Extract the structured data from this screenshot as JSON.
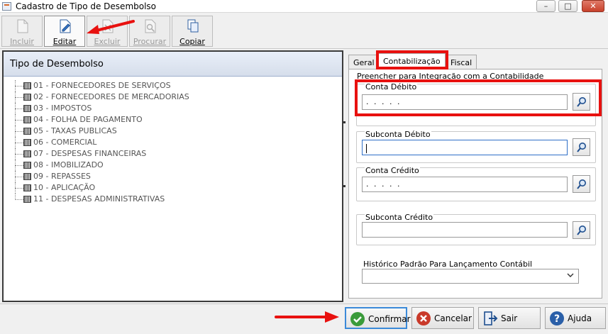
{
  "window": {
    "title": "Cadastro de Tipo de Desembolso",
    "controls": [
      "–",
      "□",
      "✕"
    ]
  },
  "toolbar": {
    "buttons": [
      {
        "label": "Incluir",
        "enabled": false
      },
      {
        "label": "Editar",
        "enabled": true
      },
      {
        "label": "Excluir",
        "enabled": false
      },
      {
        "label": "Procurar",
        "enabled": false
      },
      {
        "label": "Copiar",
        "enabled": true
      }
    ]
  },
  "left_panel": {
    "title": "Tipo de Desembolso",
    "items": [
      "01 - FORNECEDORES DE SERVIÇOS",
      "02 - FORNECEDORES DE MERCADORIAS",
      "03 - IMPOSTOS",
      "04 - FOLHA DE PAGAMENTO",
      "05 - TAXAS PUBLICAS",
      "06 - COMERCIAL",
      "07 - DESPESAS FINANCEIRAS",
      "08 - IMOBILIZADO",
      "09 - REPASSES",
      "10 - APLICAÇÃO",
      "11 - DESPESAS ADMINISTRATIVAS"
    ]
  },
  "tabs": {
    "items": [
      "Geral",
      "Contabilização",
      "Fiscal"
    ],
    "active": "Contabilização"
  },
  "form": {
    "hint": "Preencher para Integração com a Contabilidade",
    "conta_debito": {
      "label": "Conta Débito",
      "value": ". . . . ."
    },
    "subconta_debito": {
      "label": "Subconta Débito",
      "value": ""
    },
    "conta_credito": {
      "label": "Conta Crédito",
      "value": ". . . . ."
    },
    "subconta_credito": {
      "label": "Subconta Crédito",
      "value": ""
    },
    "historico": {
      "label": "Histórico Padrão Para Lançamento Contábil",
      "value": ""
    }
  },
  "bottom": {
    "confirmar": "Confirmar",
    "cancelar": "Cancelar",
    "sair": "Sair",
    "ajuda": "Ajuda"
  },
  "colors": {
    "highlight": "#e8110f",
    "focus": "#2f6fc7",
    "confirm_icon": "#3a9b3a",
    "cancel_icon": "#c9392a",
    "help_icon": "#2a5fa8"
  }
}
